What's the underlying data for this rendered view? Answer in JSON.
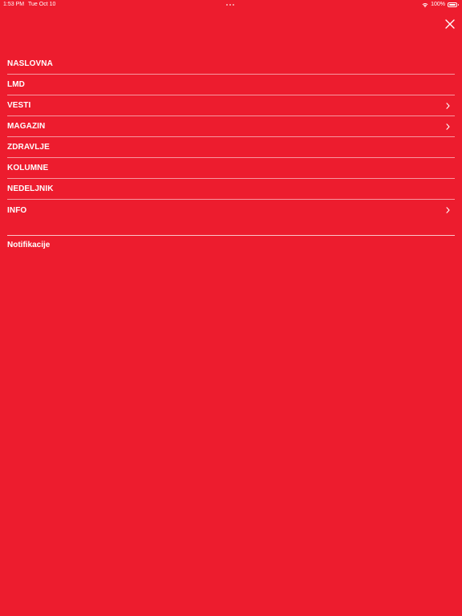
{
  "status_bar": {
    "time": "1:53 PM",
    "date": "Tue Oct 10",
    "battery": "100%",
    "icons": [
      "wifi-icon",
      "battery-icon"
    ]
  },
  "header": {
    "close_icon": "close-icon"
  },
  "menu": {
    "items": [
      {
        "label": "NASLOVNA",
        "has_submenu": false
      },
      {
        "label": "LMD",
        "has_submenu": false
      },
      {
        "label": "VESTI",
        "has_submenu": true
      },
      {
        "label": "MAGAZIN",
        "has_submenu": true
      },
      {
        "label": "ZDRAVLJE",
        "has_submenu": false
      },
      {
        "label": "KOLUMNE",
        "has_submenu": false
      },
      {
        "label": "NEDELJNIK",
        "has_submenu": false
      },
      {
        "label": "INFO",
        "has_submenu": true
      }
    ]
  },
  "footer": {
    "notifications_label": "Notifikacije"
  },
  "colors": {
    "background": "#ED1C2E",
    "text": "#FFFFFF"
  }
}
